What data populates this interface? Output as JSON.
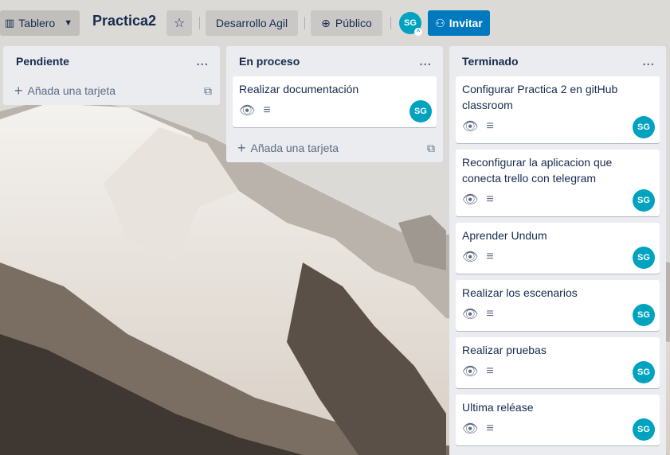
{
  "header": {
    "switcher_label": "Tablero",
    "board_title": "Practica2",
    "team_label": "Desarrollo Agil",
    "visibility_label": "Público",
    "member_initials": "SG",
    "invite_label": "Invitar"
  },
  "lists": [
    {
      "title": "Pendiente",
      "menu": "...",
      "add_card_label": "Añada una tarjeta",
      "cards": []
    },
    {
      "title": "En proceso",
      "menu": "...",
      "add_card_label": "Añada una tarjeta",
      "cards": [
        {
          "title": "Realizar documentación",
          "member": "SG"
        }
      ]
    },
    {
      "title": "Terminado",
      "menu": "...",
      "add_card_label": "",
      "cards": [
        {
          "title": "Configurar Practica 2 en gitHub classroom",
          "member": "SG"
        },
        {
          "title": "Reconfigurar la aplicacion que conecta trello con telegram",
          "member": "SG"
        },
        {
          "title": "Aprender Undum",
          "member": "SG"
        },
        {
          "title": "Realizar los escenarios",
          "member": "SG"
        },
        {
          "title": "Realizar pruebas",
          "member": "SG"
        },
        {
          "title": "Ultima reléase",
          "member": "SG"
        }
      ]
    }
  ],
  "colors": {
    "accent": "#0079bf",
    "avatar": "#00a3bf",
    "list_bg": "#ebecf0"
  }
}
